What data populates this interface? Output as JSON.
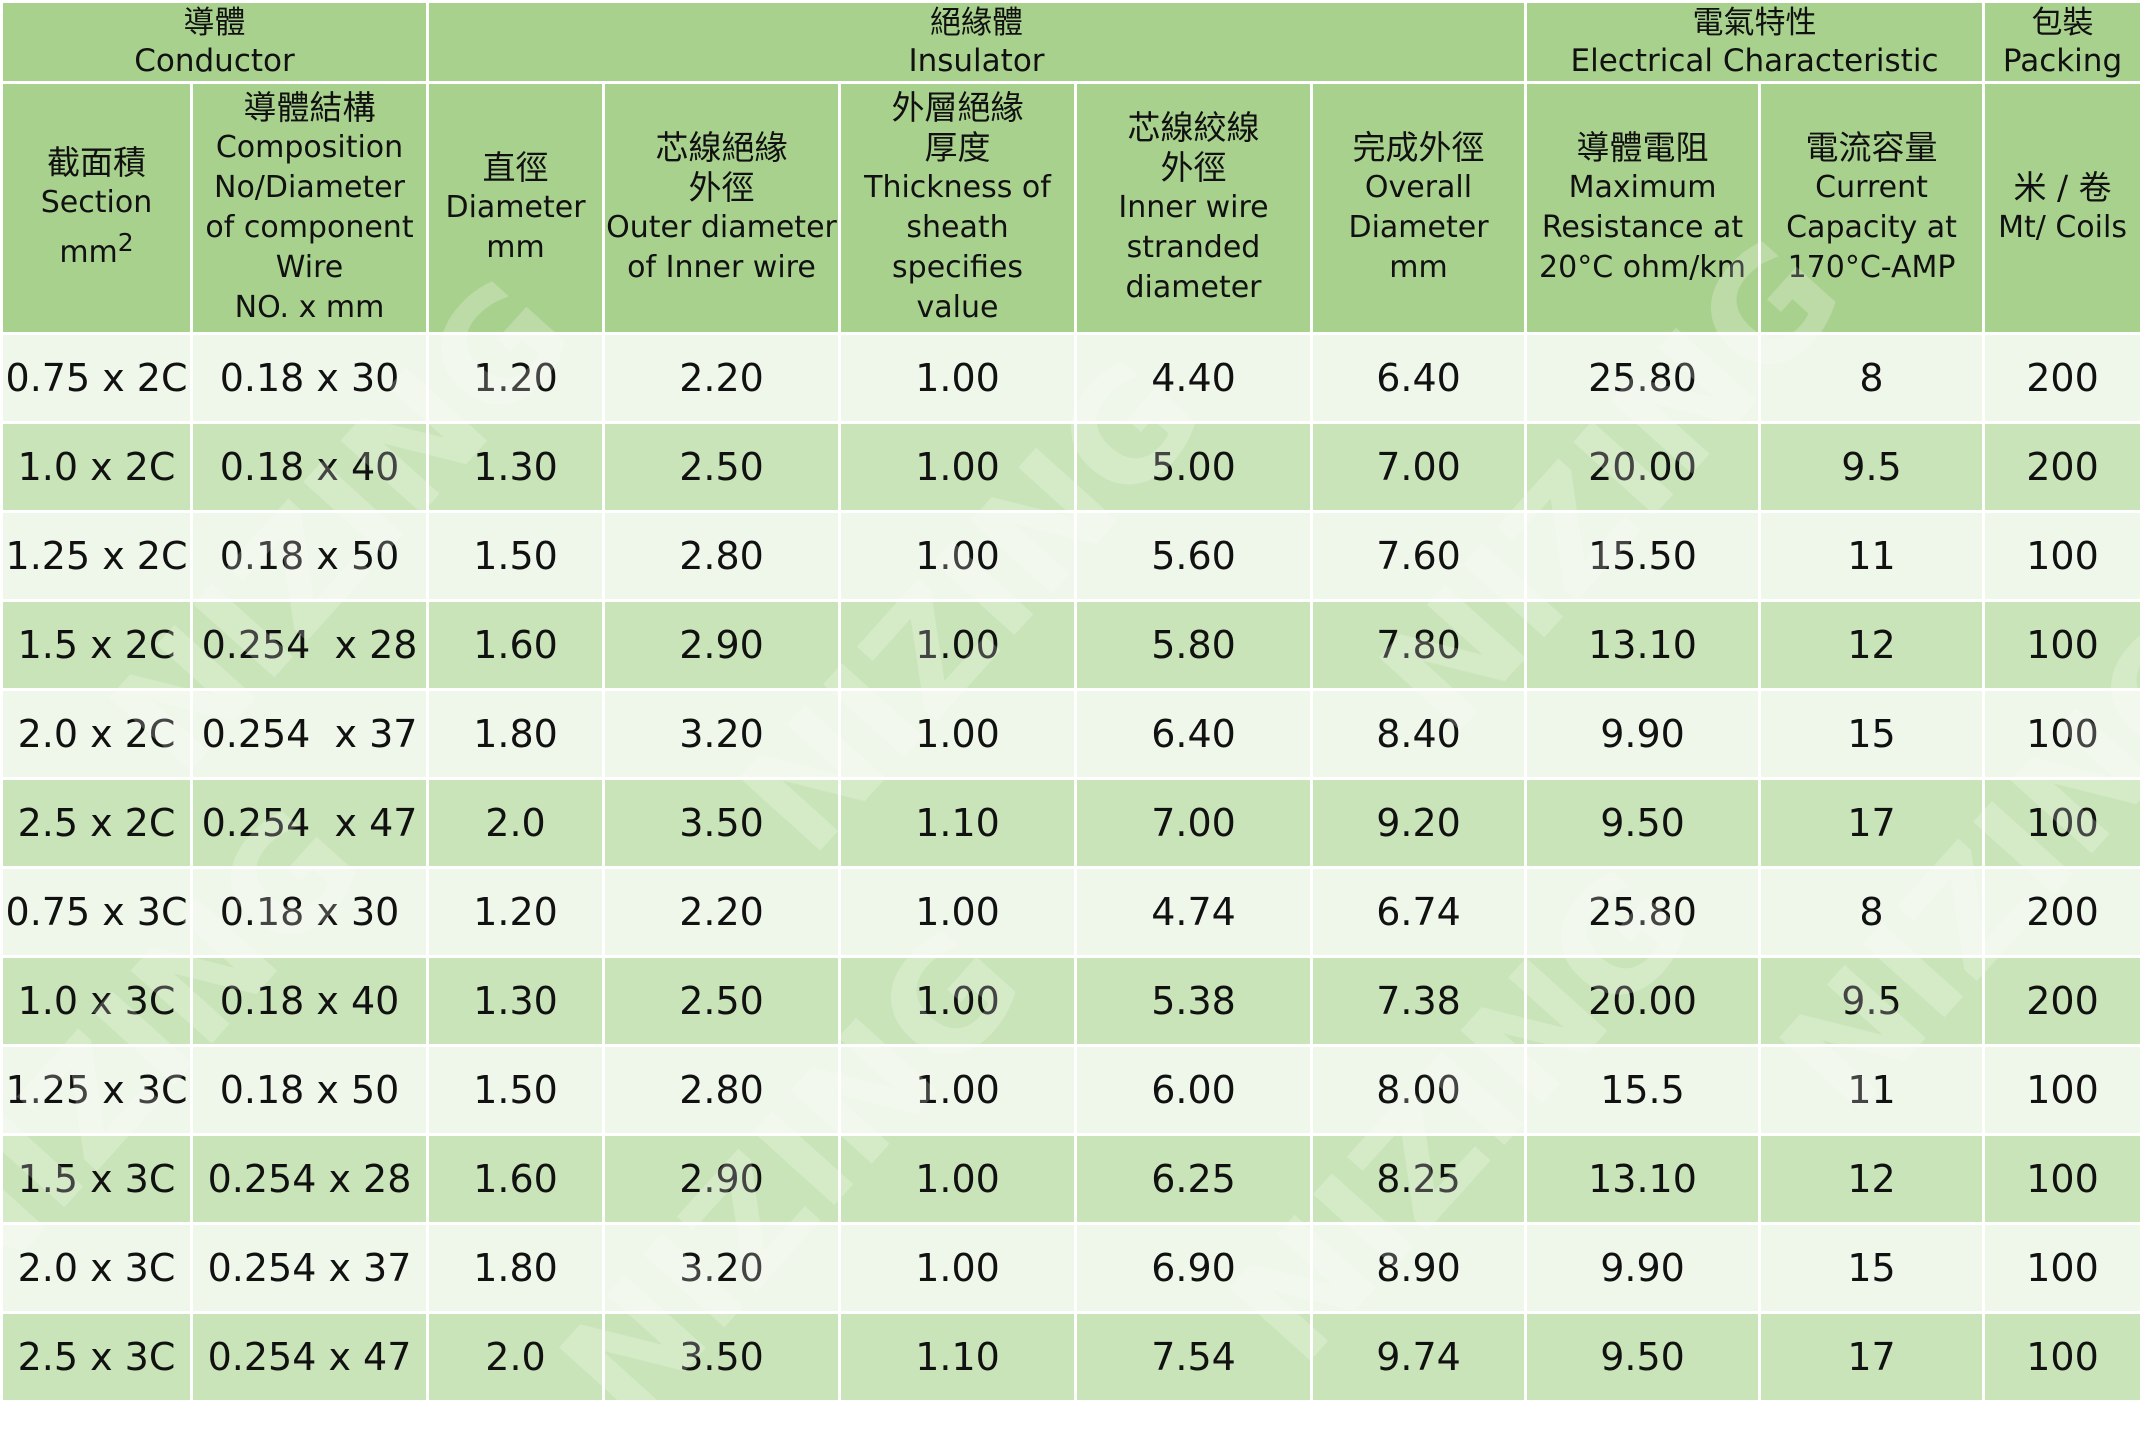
{
  "groups": [
    {
      "zh": "導體",
      "en": "Conductor"
    },
    {
      "zh": "絕緣體",
      "en": "Insulator"
    },
    {
      "zh": "電氣特性",
      "en": "Electrical Characteristic"
    },
    {
      "zh": "包裝",
      "en": "Packing"
    }
  ],
  "columns": [
    {
      "zh": "截面積",
      "en": "Section mm",
      "sup": "2"
    },
    {
      "zh": "導體結構",
      "en": "Composition\nNo/Diameter\nof component\nWire\nNO. x mm"
    },
    {
      "zh": "直徑",
      "en": "Diameter\nmm"
    },
    {
      "zh": "芯線絕緣\n外徑",
      "en": "Outer diameter\nof Inner wire"
    },
    {
      "zh": "外層絕緣\n厚度",
      "en": "Thickness of\nsheath specifies\nvalue"
    },
    {
      "zh": "芯線絞線\n外徑",
      "en": "Inner wire\nstranded\ndiameter"
    },
    {
      "zh": "完成外徑",
      "en": "Overall\nDiameter\nmm"
    },
    {
      "zh": "導體電阻",
      "en": "Maximum\nResistance at\n20°C ohm/km"
    },
    {
      "zh": "電流容量",
      "en": "Current\nCapacity at\n170°C-AMP"
    },
    {
      "zh": "米 / 卷",
      "en": "Mt/ Coils"
    }
  ],
  "rows": [
    [
      "0.75 x 2C",
      "0.18 x 30",
      "1.20",
      "2.20",
      "1.00",
      "4.40",
      "6.40",
      "25.80",
      "8",
      "200"
    ],
    [
      "1.0 x 2C",
      "0.18 x 40",
      "1.30",
      "2.50",
      "1.00",
      "5.00",
      "7.00",
      "20.00",
      "9.5",
      "200"
    ],
    [
      "1.25 x 2C",
      "0.18 x 50",
      "1.50",
      "2.80",
      "1.00",
      "5.60",
      "7.60",
      "15.50",
      "11",
      "100"
    ],
    [
      "1.5 x 2C",
      "0.254  x 28",
      "1.60",
      "2.90",
      "1.00",
      "5.80",
      "7.80",
      "13.10",
      "12",
      "100"
    ],
    [
      "2.0 x 2C",
      "0.254  x 37",
      "1.80",
      "3.20",
      "1.00",
      "6.40",
      "8.40",
      "9.90",
      "15",
      "100"
    ],
    [
      "2.5 x 2C",
      "0.254  x 47",
      "2.0",
      "3.50",
      "1.10",
      "7.00",
      "9.20",
      "9.50",
      "17",
      "100"
    ],
    [
      "0.75 x 3C",
      "0.18 x 30",
      "1.20",
      "2.20",
      "1.00",
      "4.74",
      "6.74",
      "25.80",
      "8",
      "200"
    ],
    [
      "1.0 x 3C",
      "0.18 x 40",
      "1.30",
      "2.50",
      "1.00",
      "5.38",
      "7.38",
      "20.00",
      "9.5",
      "200"
    ],
    [
      "1.25 x 3C",
      "0.18 x 50",
      "1.50",
      "2.80",
      "1.00",
      "6.00",
      "8.00",
      "15.5",
      "11",
      "100"
    ],
    [
      "1.5 x 3C",
      "0.254 x 28",
      "1.60",
      "2.90",
      "1.00",
      "6.25",
      "8.25",
      "13.10",
      "12",
      "100"
    ],
    [
      "2.0 x 3C",
      "0.254 x 37",
      "1.80",
      "3.20",
      "1.00",
      "6.90",
      "8.90",
      "9.90",
      "15",
      "100"
    ],
    [
      "2.5 x 3C",
      "0.254 x 47",
      "2.0",
      "3.50",
      "1.10",
      "7.54",
      "9.74",
      "9.50",
      "17",
      "100"
    ]
  ],
  "watermark": "NIZING",
  "colors": {
    "header": "#a9d18e",
    "row_light": "#eff6ea",
    "row_dark": "#c9e4b8",
    "border": "#ffffff"
  }
}
